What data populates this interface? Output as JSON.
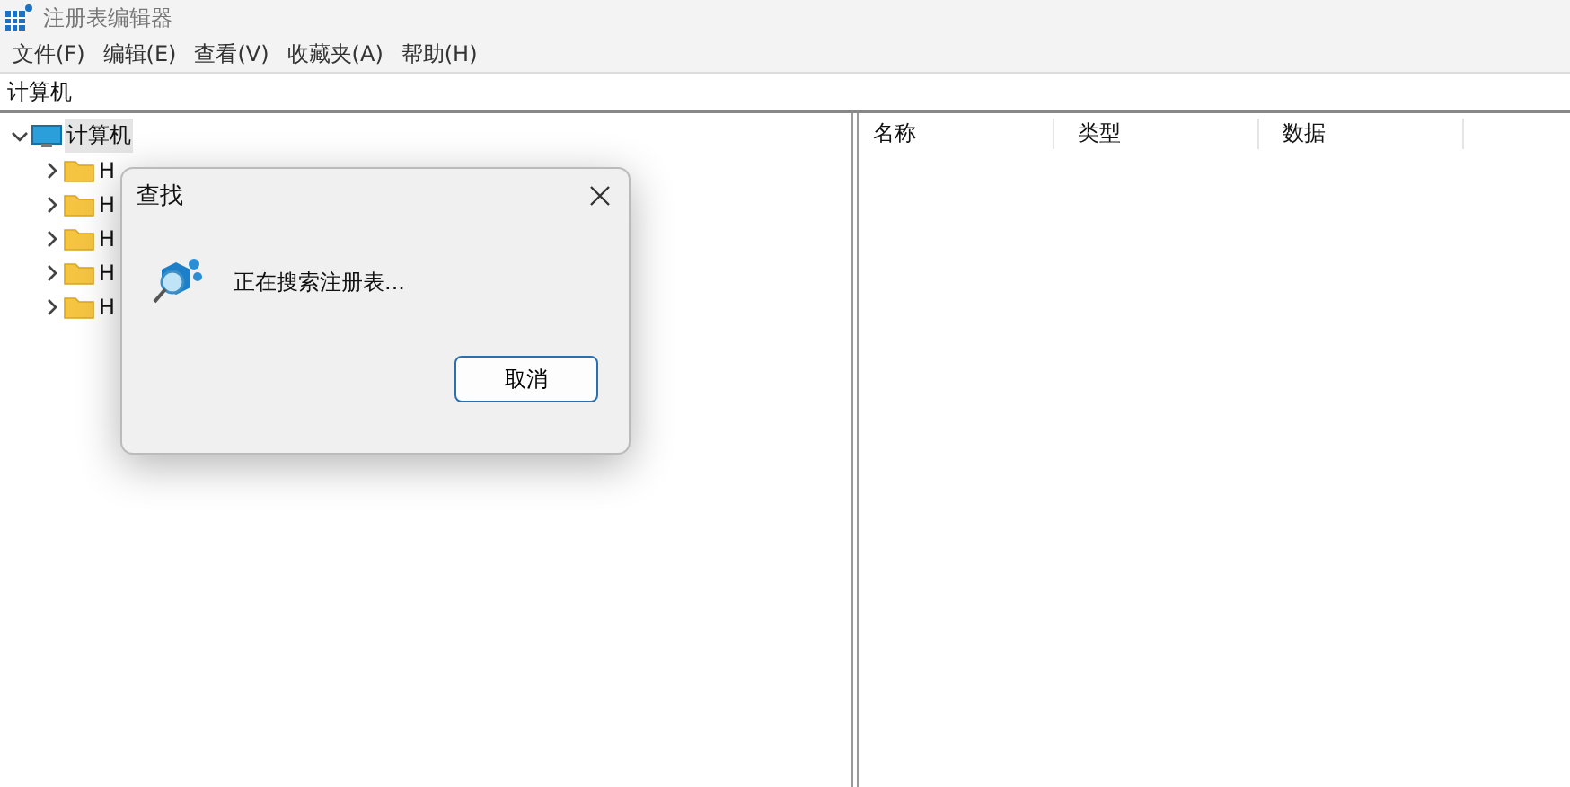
{
  "window": {
    "title": "注册表编辑器"
  },
  "menu": [
    "文件(F)",
    "编辑(E)",
    "查看(V)",
    "收藏夹(A)",
    "帮助(H)"
  ],
  "address_bar": "计算机",
  "tree": {
    "label": "计算机",
    "expanded": true,
    "selected": true,
    "children": [
      {
        "label": "H",
        "expanded": false,
        "selected": false
      },
      {
        "label": "H",
        "expanded": false,
        "selected": false
      },
      {
        "label": "H",
        "expanded": false,
        "selected": false
      },
      {
        "label": "H",
        "expanded": false,
        "selected": false
      },
      {
        "label": "H",
        "expanded": false,
        "selected": false
      }
    ]
  },
  "table": {
    "columns": [
      "名称",
      "类型",
      "数据"
    ]
  },
  "dialog": {
    "title": "查找",
    "message": "正在搜索注册表...",
    "buttons": [
      "取消"
    ]
  }
}
